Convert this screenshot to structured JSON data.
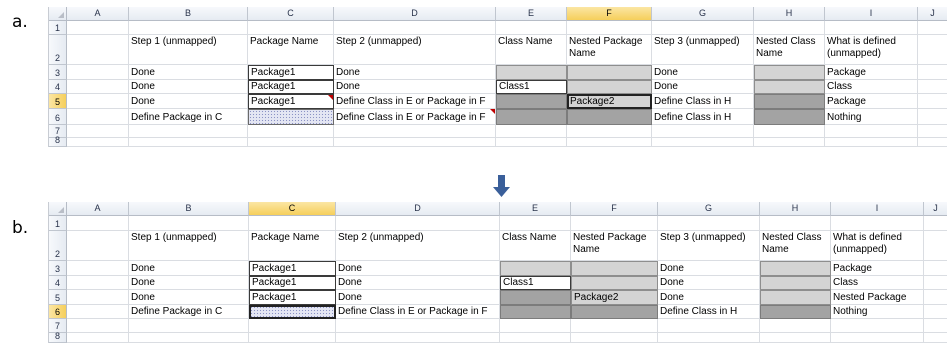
{
  "labels": {
    "a": "a.",
    "b": "b."
  },
  "columns": [
    "A",
    "B",
    "C",
    "D",
    "E",
    "F",
    "G",
    "H",
    "I",
    "J"
  ],
  "sheet_a": {
    "selected_column": "F",
    "selected_row": 5,
    "rows": [
      "1",
      "2",
      "3",
      "4",
      "5",
      "6",
      "7",
      "8"
    ],
    "header_row": {
      "B": "Step 1 (unmapped)",
      "C": "Package Name",
      "D": "Step 2 (unmapped)",
      "E": "Class Name",
      "F": "Nested Package Name",
      "G": "Step 3 (unmapped)",
      "H": "Nested Class Name",
      "I": "What is defined (unmapped)"
    },
    "data_rows": [
      {
        "B": "Done",
        "C": "Package1",
        "D": "Done",
        "E": "",
        "F": "",
        "G": "Done",
        "H": "",
        "I": "Package"
      },
      {
        "B": "Done",
        "C": "Package1",
        "D": "Done",
        "E": "Class1",
        "F": "",
        "G": "Done",
        "H": "",
        "I": "Class"
      },
      {
        "B": "Done",
        "C": "Package1",
        "D": "Define  Class in E or Package in F",
        "E": "",
        "F": "Package2",
        "G": "Define Class in H",
        "H": "",
        "I": "Package"
      },
      {
        "B": "Define Package in C",
        "C": "",
        "D": "Define  Class in E or Package in F",
        "E": "",
        "F": "",
        "G": "Define Class in H",
        "H": "",
        "I": "Nothing"
      }
    ]
  },
  "sheet_b": {
    "selected_column": "C",
    "selected_row": 6,
    "rows": [
      "1",
      "2",
      "3",
      "4",
      "5",
      "6",
      "7",
      "8"
    ],
    "header_row": {
      "B": "Step 1 (unmapped)",
      "C": "Package Name",
      "D": "Step 2 (unmapped)",
      "E": "Class Name",
      "F": "Nested Package Name",
      "G": "Step 3 (unmapped)",
      "H": "Nested Class Name",
      "I": "What is defined (unmapped)"
    },
    "data_rows": [
      {
        "B": "Done",
        "C": "Package1",
        "D": "Done",
        "E": "",
        "F": "",
        "G": "Done",
        "H": "",
        "I": "Package"
      },
      {
        "B": "Done",
        "C": "Package1",
        "D": "Done",
        "E": "Class1",
        "F": "",
        "G": "Done",
        "H": "",
        "I": "Class"
      },
      {
        "B": "Done",
        "C": "Package1",
        "D": "Done",
        "E": "",
        "F": "Package2",
        "G": "Done",
        "H": "",
        "I": "Nested Package"
      },
      {
        "B": "Define Package in C",
        "C": "",
        "D": "Define  Class in E or Package in F",
        "E": "",
        "F": "",
        "G": "Define Class in H",
        "H": "",
        "I": "Nothing"
      }
    ]
  },
  "colors": {
    "arrow": "#3a5f9a",
    "selected_header": "#f6cf5b",
    "gray_fill": "#d4d4d4",
    "dark_fill": "#a3a3a3",
    "comment_marker": "#c00000"
  }
}
